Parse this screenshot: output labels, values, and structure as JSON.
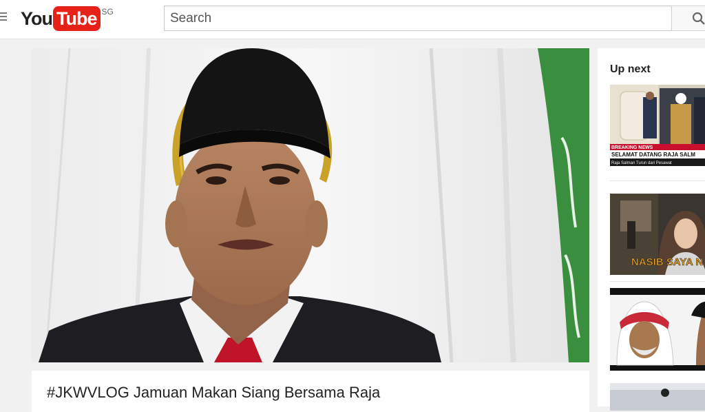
{
  "header": {
    "menu_icon": "hamburger-menu-icon",
    "logo_you": "You",
    "logo_tube": "Tube",
    "logo_country": "SG",
    "search_placeholder": "Search",
    "search_icon": "search-icon"
  },
  "video": {
    "title": "#JKWVLOG Jamuan Makan Siang Bersama Raja"
  },
  "sidebar": {
    "heading": "Up next",
    "items": [
      {
        "breaking": "BREAKING NEWS",
        "headline": "SELAMAT DATANG RAJA SALM",
        "subline": "Raja Salman Turun dari Pesawat"
      },
      {
        "overlay": "NASIB SAYA N"
      },
      {
        "overlay": ""
      }
    ]
  },
  "colors": {
    "brand_red": "#e62117",
    "flag_green": "#3a8f3e",
    "breaking_red": "#c8102e",
    "caption_orange": "#f5a623"
  }
}
